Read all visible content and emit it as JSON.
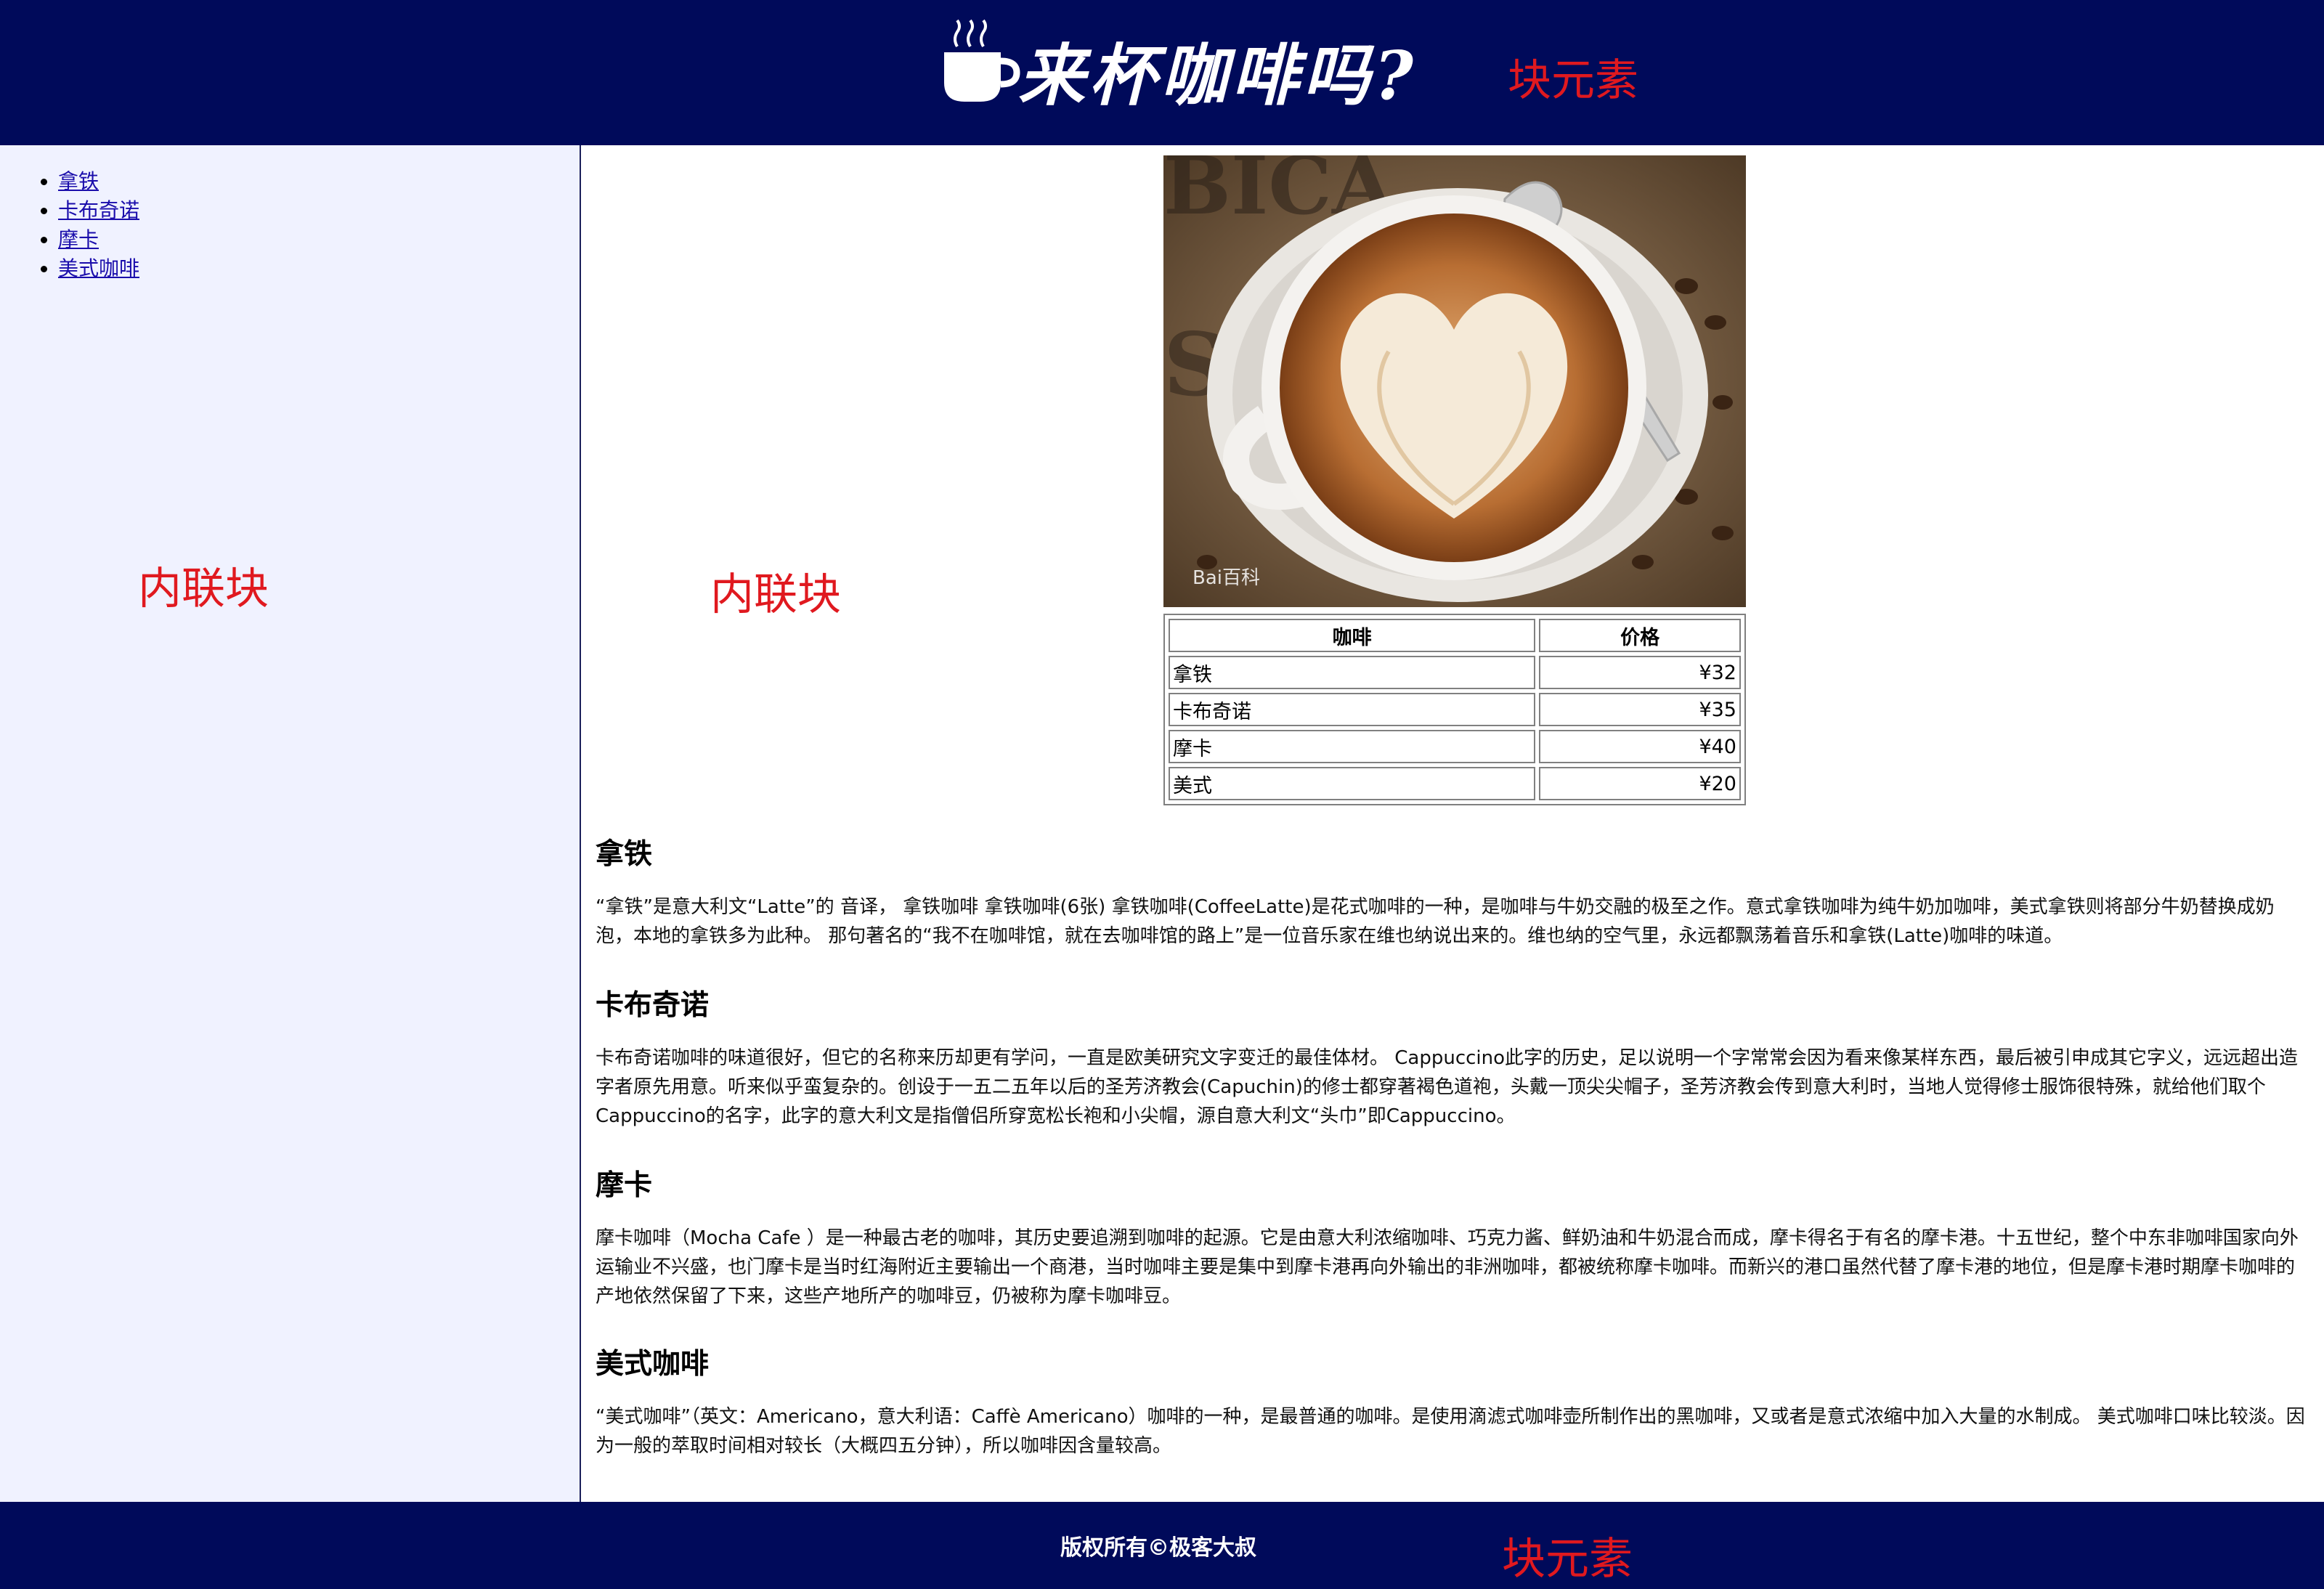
{
  "header": {
    "logo_icon": "coffee-cup-icon",
    "title": "来杯咖啡吗?",
    "annotation": "块元素",
    "background": "#000a5a"
  },
  "sidebar": {
    "annotation": "内联块",
    "items": [
      {
        "label": "拿铁"
      },
      {
        "label": "卡布奇诺"
      },
      {
        "label": "摩卡"
      },
      {
        "label": "美式咖啡"
      }
    ]
  },
  "main": {
    "annotation": "内联块",
    "image_watermark": "Bai百科",
    "price_table": {
      "headers": [
        "咖啡",
        "价格"
      ],
      "rows": [
        {
          "name": "拿铁",
          "price": "¥32"
        },
        {
          "name": "卡布奇诺",
          "price": "¥35"
        },
        {
          "name": "摩卡",
          "price": "¥40"
        },
        {
          "name": "美式",
          "price": "¥20"
        }
      ]
    },
    "sections": [
      {
        "heading": "拿铁",
        "text": "“拿铁”是意大利文“Latte”的 音译， 拿铁咖啡 拿铁咖啡(6张) 拿铁咖啡(CoffeeLatte)是花式咖啡的一种，是咖啡与牛奶交融的极至之作。意式拿铁咖啡为纯牛奶加咖啡，美式拿铁则将部分牛奶替换成奶泡，本地的拿铁多为此种。 那句著名的“我不在咖啡馆，就在去咖啡馆的路上”是一位音乐家在维也纳说出来的。维也纳的空气里，永远都飘荡着音乐和拿铁(Latte)咖啡的味道。"
      },
      {
        "heading": "卡布奇诺",
        "text": "卡布奇诺咖啡的味道很好，但它的名称来历却更有学问，一直是欧美研究文字变迁的最佳体材。 Cappuccino此字的历史，足以说明一个字常常会因为看来像某样东西，最后被引申成其它字义，远远超出造字者原先用意。听来似乎蛮复杂的。创设于一五二五年以后的圣芳济教会(Capuchin)的修士都穿著褐色道袍，头戴一顶尖尖帽子，圣芳济教会传到意大利时，当地人觉得修士服饰很特殊，就给他们取个Cappuccino的名字，此字的意大利文是指僧侣所穿宽松长袍和小尖帽，源自意大利文“头巾”即Cappuccino。"
      },
      {
        "heading": "摩卡",
        "text": "摩卡咖啡（Mocha Cafe ）是一种最古老的咖啡，其历史要追溯到咖啡的起源。它是由意大利浓缩咖啡、巧克力酱、鲜奶油和牛奶混合而成，摩卡得名于有名的摩卡港。十五世纪，整个中东非咖啡国家向外运输业不兴盛，也门摩卡是当时红海附近主要输出一个商港，当时咖啡主要是集中到摩卡港再向外输出的非洲咖啡，都被统称摩卡咖啡。而新兴的港口虽然代替了摩卡港的地位，但是摩卡港时期摩卡咖啡的产地依然保留了下来，这些产地所产的咖啡豆，仍被称为摩卡咖啡豆。"
      },
      {
        "heading": "美式咖啡",
        "text": "“美式咖啡”（英文：Americano，意大利语：Caffè Americano）咖啡的一种，是最普通的咖啡。是使用滴滤式咖啡壶所制作出的黑咖啡，又或者是意式浓缩中加入大量的水制成。 美式咖啡口味比较淡。因为一般的萃取时间相对较长（大概四五分钟），所以咖啡因含量较高。"
      }
    ]
  },
  "footer": {
    "copyright": "版权所有©极客大叔",
    "annotation": "块元素"
  }
}
